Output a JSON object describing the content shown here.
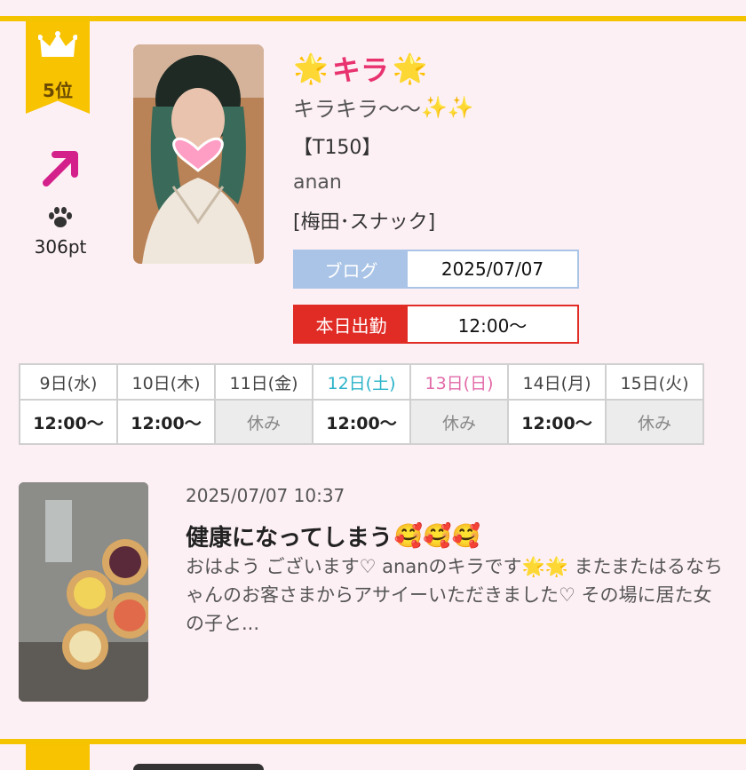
{
  "ranking": {
    "rank_label": "5位",
    "trend": "up",
    "points": "306pt"
  },
  "profile": {
    "name": "キラ",
    "catchphrase": "キラキラ〜〜",
    "height": "【T150】",
    "shop": "anan",
    "area": "[梅田･スナック]"
  },
  "blog": {
    "label": "ブログ",
    "date": "2025/07/07"
  },
  "work": {
    "label": "本日出勤",
    "time": "12:00〜"
  },
  "schedule": {
    "days": [
      "9日(水)",
      "10日(木)",
      "11日(金)",
      "12日(土)",
      "13日(日)",
      "14日(月)",
      "15日(火)"
    ],
    "times": [
      "12:00〜",
      "12:00〜",
      "休み",
      "12:00〜",
      "休み",
      "12:00〜",
      "休み"
    ]
  },
  "post": {
    "datetime": "2025/07/07 10:37",
    "title": "健康になってしまう",
    "excerpt": "おはよう ございます♡ ananのキラです🌟🌟 またまたはるなちゃんのお客さまからアサイーいただきました♡ その場に居た女の子と..."
  },
  "colors": {
    "accent_pink": "#e8336f",
    "ribbon_gold": "#f8c300",
    "blog_blue": "#a9c4e6",
    "work_red": "#e02c25",
    "saturday": "#2bb3c9",
    "sunday": "#e26aa8"
  }
}
